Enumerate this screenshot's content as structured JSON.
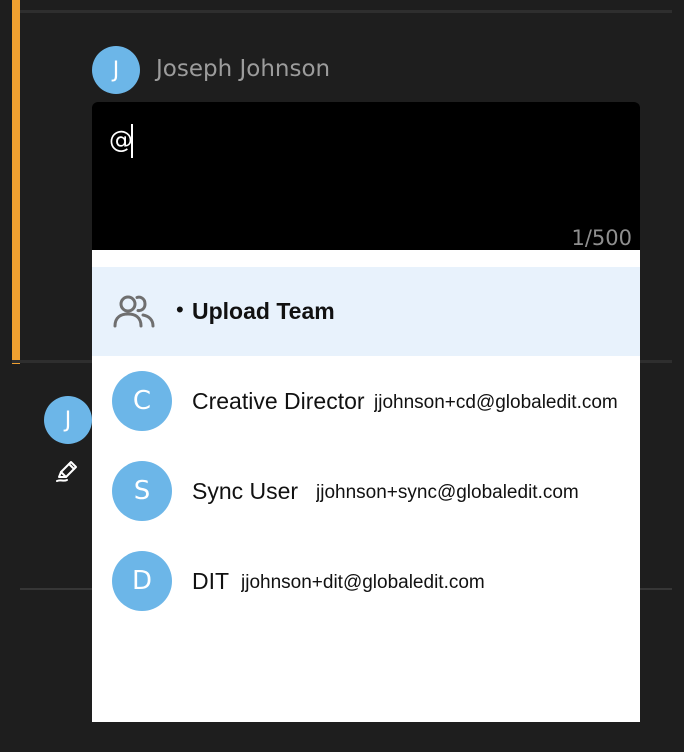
{
  "comment": {
    "author": {
      "initial": "J",
      "name": "Joseph Johnson"
    },
    "composer": {
      "text": "@",
      "char_count": "1/500"
    }
  },
  "reply": {
    "avatar_initial": "J",
    "edit_icon": "edit-pen-icon"
  },
  "mentions": {
    "team": {
      "icon": "users-group-icon",
      "bullet": "•",
      "label": "Upload Team"
    },
    "users": [
      {
        "initial": "C",
        "name": "Creative Director",
        "email": "jjohnson+cd@globaledit.com"
      },
      {
        "initial": "S",
        "name": "Sync User",
        "email": "jjohnson+sync@globaledit.com"
      },
      {
        "initial": "D",
        "name": "DIT",
        "email": "jjohnson+dit@globaledit.com"
      }
    ]
  },
  "colors": {
    "accent": "#f0a030",
    "avatar": "#6cb6e8",
    "highlight": "#e8f2fc"
  }
}
